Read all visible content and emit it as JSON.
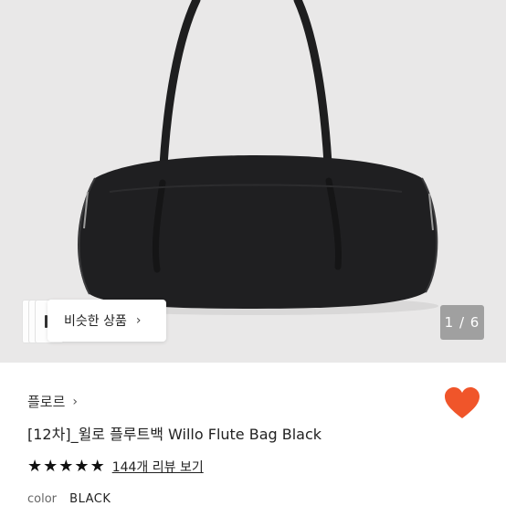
{
  "hero": {
    "similar_label": "비슷한 상품",
    "similar_chevron": "›",
    "counter": "1 / 6"
  },
  "product": {
    "shop_name": "플로르",
    "shop_chevron": "›",
    "title": "[12차]_윌로 플루트백 Willo Flute Bag Black",
    "rating_stars": 5,
    "star_glyph": "★",
    "reviews_label": "144개 리뷰 보기",
    "color_label": "color",
    "color_value": "BLACK",
    "heart_color": "#f0552a"
  }
}
